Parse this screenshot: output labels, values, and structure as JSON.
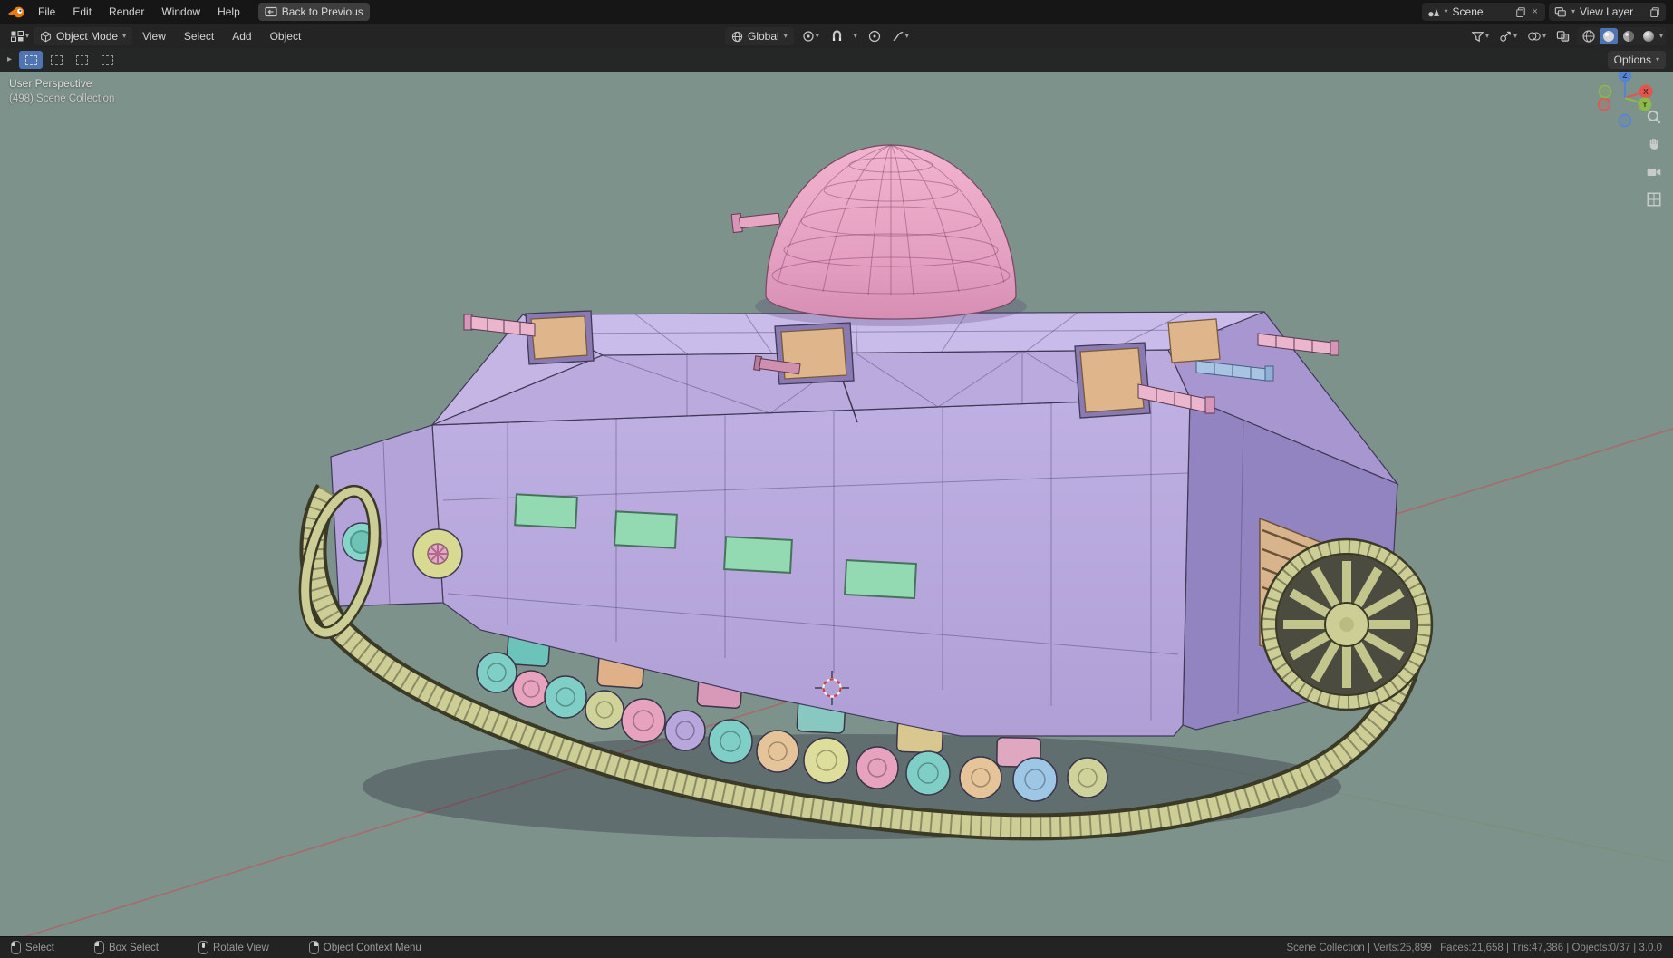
{
  "topbar": {
    "menus": [
      {
        "label": "File"
      },
      {
        "label": "Edit"
      },
      {
        "label": "Render"
      },
      {
        "label": "Window"
      },
      {
        "label": "Help"
      }
    ],
    "back_button": {
      "label": "Back to Previous"
    },
    "scene_selector": {
      "label": "Scene"
    },
    "view_layer_selector": {
      "label": "View Layer"
    }
  },
  "viewport_header": {
    "mode_dropdown": {
      "value": "Object Mode"
    },
    "menus": [
      {
        "label": "View"
      },
      {
        "label": "Select"
      },
      {
        "label": "Add"
      },
      {
        "label": "Object"
      }
    ],
    "orientation_dropdown": {
      "value": "Global"
    }
  },
  "tool_header": {
    "options_button": {
      "label": "Options"
    }
  },
  "viewport": {
    "view_label": "User Perspective",
    "collection_label": "(498) Scene Collection"
  },
  "status_bar": {
    "hints": [
      {
        "label": "Select",
        "button": "left-click"
      },
      {
        "label": "Box Select",
        "button": "left-drag"
      },
      {
        "label": "Rotate View",
        "button": "middle-click"
      },
      {
        "label": "Object Context Menu",
        "button": "right-click"
      }
    ],
    "stats": "Scene Collection | Verts:25,899 | Faces:21,658 | Tris:47,386 | Objects:0/37 | 3.0.0"
  },
  "glyphs": {
    "chevron_down": "▾",
    "close": "×",
    "expand_arrow": "▸"
  },
  "colors": {
    "accent_blue": "#4f74b3",
    "viewport_background": "#7e928c",
    "hull_lavender": "#b7a7dd",
    "dome_pink": "#e8a9c6",
    "track_khaki": "#ccce96",
    "window_green": "#93dab2",
    "axis_red": "#c44a54"
  }
}
